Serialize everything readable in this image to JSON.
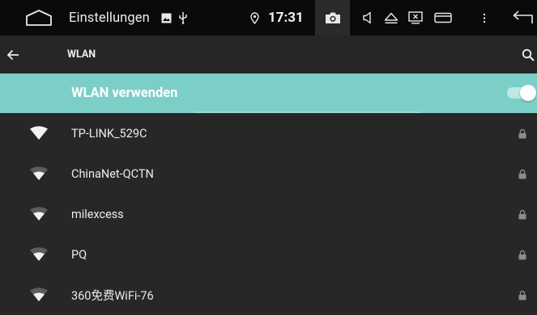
{
  "statusbar": {
    "app_title": "Einstellungen",
    "clock": "17:31",
    "icons": [
      "home-icon",
      "image-icon",
      "usb-icon",
      "location-icon",
      "camera-icon",
      "volume-icon",
      "eject-icon",
      "screenshot-icon",
      "window-icon",
      "more-vert-icon",
      "back-icon"
    ]
  },
  "toolbar": {
    "title": "WLAN",
    "icons": [
      "arrow-back-icon",
      "search-icon"
    ]
  },
  "wifi_switch": {
    "label": "WLAN verwenden",
    "enabled": true,
    "accent": "#7ccfc7"
  },
  "networks": [
    {
      "name": "TP-LINK_529C",
      "secured": true,
      "signal": "full"
    },
    {
      "name": "ChinaNet-QCTN",
      "secured": true,
      "signal": "medium"
    },
    {
      "name": "milexcess",
      "secured": true,
      "signal": "medium"
    },
    {
      "name": "PQ",
      "secured": true,
      "signal": "medium"
    },
    {
      "name": "360免费WiFi-76",
      "secured": true,
      "signal": "medium"
    }
  ]
}
